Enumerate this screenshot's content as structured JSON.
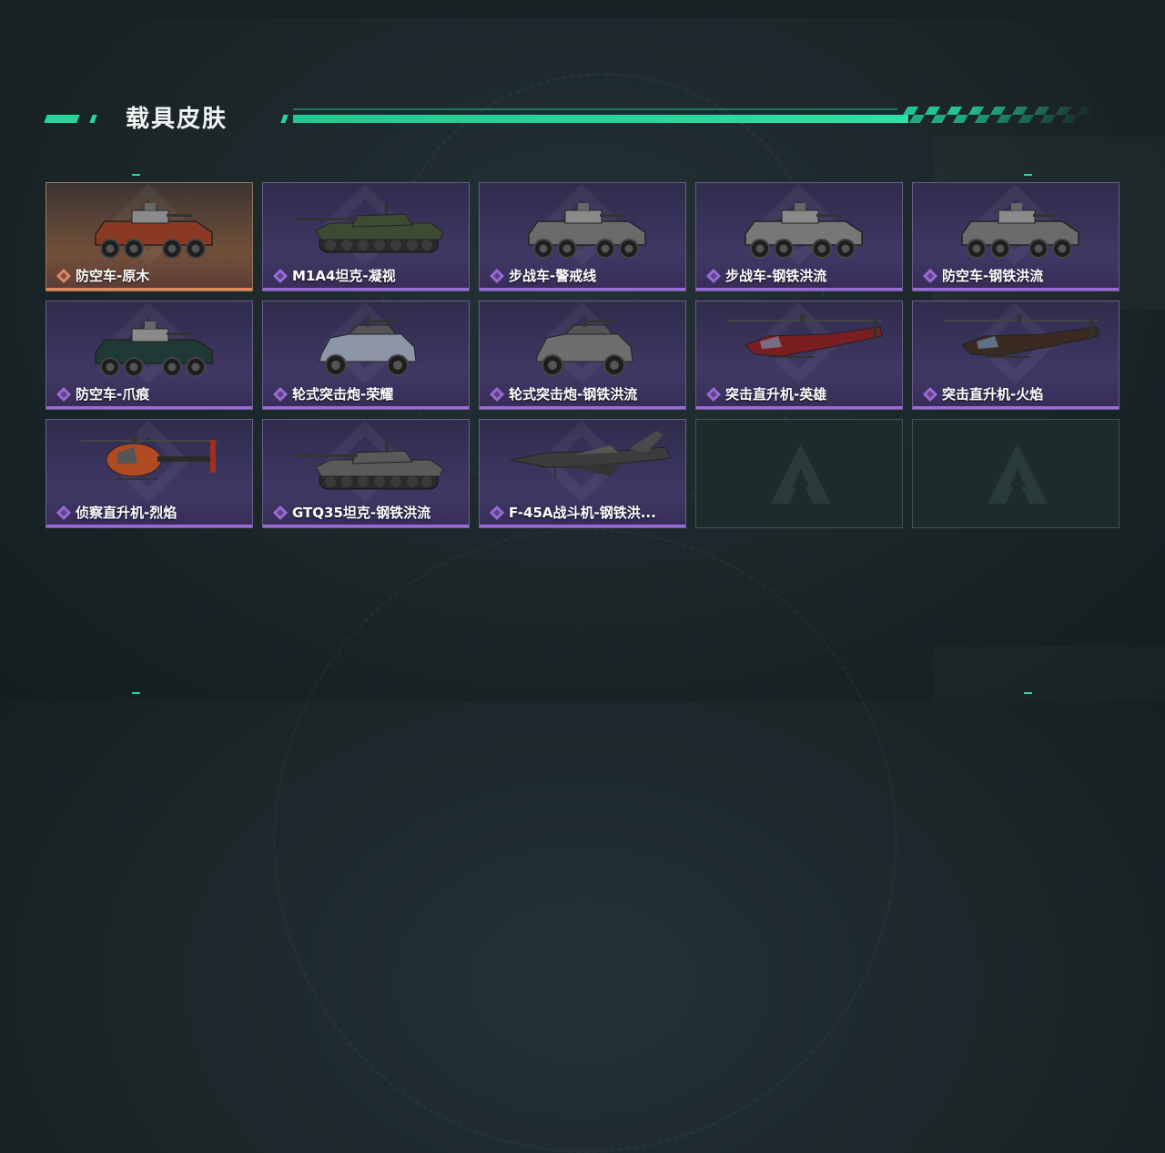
{
  "header": {
    "title": "载具皮肤"
  },
  "colors": {
    "accent": "#25d59a",
    "rare_purple": "#9a6ad8",
    "rare_orange": "#e0895a"
  },
  "skins": [
    {
      "name": "防空车-原木",
      "rarity": "orange",
      "vehicle": "apc",
      "tint": "#8a3a22"
    },
    {
      "name": "M1A4坦克-凝视",
      "rarity": "purple",
      "vehicle": "tank",
      "tint": "#3d4a34"
    },
    {
      "name": "步战车-警戒线",
      "rarity": "purple",
      "vehicle": "apc",
      "tint": "#6a6a6a"
    },
    {
      "name": "步战车-钢铁洪流",
      "rarity": "purple",
      "vehicle": "apc",
      "tint": "#777777"
    },
    {
      "name": "防空车-钢铁洪流",
      "rarity": "purple",
      "vehicle": "apc",
      "tint": "#6b6b6b"
    },
    {
      "name": "防空车-爪痕",
      "rarity": "purple",
      "vehicle": "apc",
      "tint": "#1f3a34"
    },
    {
      "name": "轮式突击炮-荣耀",
      "rarity": "purple",
      "vehicle": "car",
      "tint": "#8c96a8"
    },
    {
      "name": "轮式突击炮-钢铁洪流",
      "rarity": "purple",
      "vehicle": "car",
      "tint": "#6e6e6e"
    },
    {
      "name": "突击直升机-英雄",
      "rarity": "purple",
      "vehicle": "heli",
      "tint": "#7a1e22"
    },
    {
      "name": "突击直升机-火焰",
      "rarity": "purple",
      "vehicle": "heli",
      "tint": "#3a2a22"
    },
    {
      "name": "侦察直升机-烈焰",
      "rarity": "purple",
      "vehicle": "scout",
      "tint": "#b04a22"
    },
    {
      "name": "GTQ35坦克-钢铁洪流",
      "rarity": "purple",
      "vehicle": "tank",
      "tint": "#5a5a58"
    },
    {
      "name": "F-45A战斗机-钢铁洪...",
      "rarity": "purple",
      "vehicle": "jet",
      "tint": "#3c3c3e"
    }
  ],
  "empty_slots": 2
}
